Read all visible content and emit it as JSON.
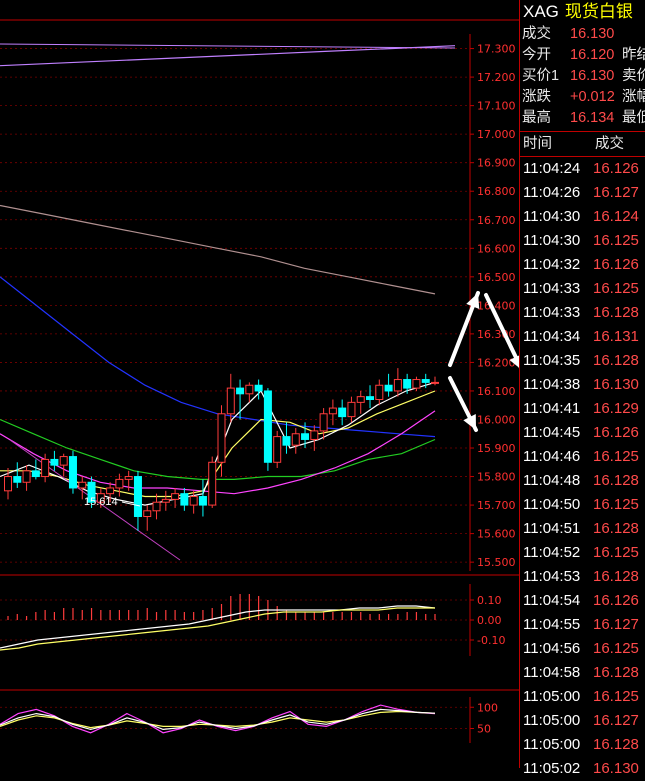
{
  "header": {
    "code": "XAG",
    "name": "现货白银"
  },
  "quote": [
    {
      "label": "成交",
      "value": "16.130",
      "extra": ""
    },
    {
      "label": "今开",
      "value": "16.120",
      "extra": "昨结"
    },
    {
      "label": "买价1",
      "value": "16.130",
      "extra": "卖价"
    },
    {
      "label": "涨跌",
      "value": "+0.012",
      "extra": "涨幅"
    },
    {
      "label": "最高",
      "value": "16.134",
      "extra": "最低"
    }
  ],
  "trades_header": {
    "time": "时间",
    "price": "成交"
  },
  "trades": [
    {
      "time": "11:04:24",
      "price": "16.126"
    },
    {
      "time": "11:04:26",
      "price": "16.127"
    },
    {
      "time": "11:04:30",
      "price": "16.124"
    },
    {
      "time": "11:04:30",
      "price": "16.125"
    },
    {
      "time": "11:04:32",
      "price": "16.126"
    },
    {
      "time": "11:04:33",
      "price": "16.125"
    },
    {
      "time": "11:04:33",
      "price": "16.128"
    },
    {
      "time": "11:04:34",
      "price": "16.131"
    },
    {
      "time": "11:04:35",
      "price": "16.128"
    },
    {
      "time": "11:04:38",
      "price": "16.130"
    },
    {
      "time": "11:04:41",
      "price": "16.129"
    },
    {
      "time": "11:04:45",
      "price": "16.126"
    },
    {
      "time": "11:04:46",
      "price": "16.125"
    },
    {
      "time": "11:04:48",
      "price": "16.128"
    },
    {
      "time": "11:04:50",
      "price": "16.125"
    },
    {
      "time": "11:04:51",
      "price": "16.128"
    },
    {
      "time": "11:04:52",
      "price": "16.125"
    },
    {
      "time": "11:04:53",
      "price": "16.128"
    },
    {
      "time": "11:04:54",
      "price": "16.126"
    },
    {
      "time": "11:04:55",
      "price": "16.127"
    },
    {
      "time": "11:04:56",
      "price": "16.125"
    },
    {
      "time": "11:04:58",
      "price": "16.128"
    },
    {
      "time": "11:05:00",
      "price": "16.125"
    },
    {
      "time": "11:05:00",
      "price": "16.127"
    },
    {
      "time": "11:05:00",
      "price": "16.128"
    },
    {
      "time": "11:05:02",
      "price": "16.130"
    }
  ],
  "chart_data": [
    {
      "type": "candlestick",
      "ylim": [
        15.49,
        17.33
      ],
      "yticks": [
        "17.300",
        "17.200",
        "17.100",
        "17.000",
        "16.900",
        "16.800",
        "16.700",
        "16.600",
        "16.500",
        "16.400",
        "16.300",
        "16.200",
        "16.100",
        "16.000",
        "15.900",
        "15.800",
        "15.700",
        "15.600",
        "15.500"
      ],
      "annotation": "15.614",
      "colors": {
        "up": "#ff3c3c",
        "down": "#00ffff",
        "axis": "#ff3030",
        "grid": "#8b0000"
      },
      "candles": [
        {
          "o": 15.75,
          "h": 15.83,
          "l": 15.72,
          "c": 15.8
        },
        {
          "o": 15.8,
          "h": 15.85,
          "l": 15.76,
          "c": 15.78
        },
        {
          "o": 15.78,
          "h": 15.84,
          "l": 15.75,
          "c": 15.82
        },
        {
          "o": 15.82,
          "h": 15.86,
          "l": 15.79,
          "c": 15.8
        },
        {
          "o": 15.8,
          "h": 15.88,
          "l": 15.78,
          "c": 15.86
        },
        {
          "o": 15.86,
          "h": 15.89,
          "l": 15.82,
          "c": 15.84
        },
        {
          "o": 15.84,
          "h": 15.88,
          "l": 15.8,
          "c": 15.87
        },
        {
          "o": 15.87,
          "h": 15.89,
          "l": 15.74,
          "c": 15.76
        },
        {
          "o": 15.76,
          "h": 15.8,
          "l": 15.72,
          "c": 15.78
        },
        {
          "o": 15.78,
          "h": 15.8,
          "l": 15.69,
          "c": 15.71
        },
        {
          "o": 15.71,
          "h": 15.76,
          "l": 15.69,
          "c": 15.74
        },
        {
          "o": 15.74,
          "h": 15.78,
          "l": 15.71,
          "c": 15.76
        },
        {
          "o": 15.76,
          "h": 15.81,
          "l": 15.73,
          "c": 15.79
        },
        {
          "o": 15.79,
          "h": 15.82,
          "l": 15.75,
          "c": 15.8
        },
        {
          "o": 15.8,
          "h": 15.82,
          "l": 15.61,
          "c": 15.66
        },
        {
          "o": 15.66,
          "h": 15.7,
          "l": 15.61,
          "c": 15.68
        },
        {
          "o": 15.68,
          "h": 15.74,
          "l": 15.65,
          "c": 15.71
        },
        {
          "o": 15.71,
          "h": 15.75,
          "l": 15.68,
          "c": 15.72
        },
        {
          "o": 15.72,
          "h": 15.76,
          "l": 15.69,
          "c": 15.74
        },
        {
          "o": 15.74,
          "h": 15.76,
          "l": 15.68,
          "c": 15.7
        },
        {
          "o": 15.7,
          "h": 15.75,
          "l": 15.67,
          "c": 15.73
        },
        {
          "o": 15.73,
          "h": 15.79,
          "l": 15.66,
          "c": 15.7
        },
        {
          "o": 15.7,
          "h": 15.87,
          "l": 15.69,
          "c": 15.85
        },
        {
          "o": 15.85,
          "h": 16.05,
          "l": 15.8,
          "c": 16.02
        },
        {
          "o": 16.02,
          "h": 16.16,
          "l": 15.99,
          "c": 16.11
        },
        {
          "o": 16.11,
          "h": 16.14,
          "l": 16.0,
          "c": 16.09
        },
        {
          "o": 16.09,
          "h": 16.13,
          "l": 16.06,
          "c": 16.12
        },
        {
          "o": 16.12,
          "h": 16.14,
          "l": 16.07,
          "c": 16.1
        },
        {
          "o": 16.1,
          "h": 16.11,
          "l": 15.82,
          "c": 15.85
        },
        {
          "o": 15.85,
          "h": 15.96,
          "l": 15.83,
          "c": 15.94
        },
        {
          "o": 15.94,
          "h": 15.99,
          "l": 15.88,
          "c": 15.91
        },
        {
          "o": 15.91,
          "h": 15.97,
          "l": 15.88,
          "c": 15.95
        },
        {
          "o": 15.95,
          "h": 15.99,
          "l": 15.9,
          "c": 15.93
        },
        {
          "o": 15.93,
          "h": 15.98,
          "l": 15.89,
          "c": 15.96
        },
        {
          "o": 15.96,
          "h": 16.04,
          "l": 15.93,
          "c": 16.02
        },
        {
          "o": 16.02,
          "h": 16.07,
          "l": 15.98,
          "c": 16.04
        },
        {
          "o": 16.04,
          "h": 16.07,
          "l": 15.98,
          "c": 16.01
        },
        {
          "o": 16.01,
          "h": 16.08,
          "l": 15.99,
          "c": 16.06
        },
        {
          "o": 16.06,
          "h": 16.1,
          "l": 16.02,
          "c": 16.08
        },
        {
          "o": 16.08,
          "h": 16.12,
          "l": 16.04,
          "c": 16.07
        },
        {
          "o": 16.07,
          "h": 16.14,
          "l": 16.05,
          "c": 16.12
        },
        {
          "o": 16.12,
          "h": 16.16,
          "l": 16.08,
          "c": 16.1
        },
        {
          "o": 16.1,
          "h": 16.18,
          "l": 16.08,
          "c": 16.14
        },
        {
          "o": 16.14,
          "h": 16.16,
          "l": 16.09,
          "c": 16.11
        },
        {
          "o": 16.11,
          "h": 16.15,
          "l": 16.1,
          "c": 16.14
        },
        {
          "o": 16.14,
          "h": 16.16,
          "l": 16.11,
          "c": 16.13
        },
        {
          "o": 16.13,
          "h": 16.15,
          "l": 16.12,
          "c": 16.13
        }
      ],
      "lines": [
        {
          "color": "#c080ff",
          "values": [
            17.24,
            17.25,
            17.26,
            17.27,
            17.28,
            17.29,
            17.3,
            17.31
          ]
        },
        {
          "color": "#b09090",
          "values": [
            16.75,
            16.72,
            16.69,
            16.66,
            16.63,
            16.6,
            16.57,
            16.53,
            16.5,
            16.47,
            16.44
          ]
        },
        {
          "color": "#2233ff",
          "values": [
            16.5,
            16.4,
            16.3,
            16.2,
            16.12,
            16.06,
            16.02,
            16.0,
            15.98,
            15.97,
            15.96,
            15.95,
            15.94
          ]
        },
        {
          "color": "#22cc22",
          "values": [
            16.0,
            15.95,
            15.9,
            15.86,
            15.82,
            15.8,
            15.79,
            15.79,
            15.8,
            15.8,
            15.82,
            15.86,
            15.88,
            15.93
          ]
        },
        {
          "color": "#ff44ff",
          "values": [
            15.95,
            15.88,
            15.82,
            15.78,
            15.76,
            15.76,
            15.75,
            15.74,
            15.76,
            15.79,
            15.83,
            15.88,
            15.95,
            16.03
          ]
        },
        {
          "color": "#ffff66",
          "values": [
            15.82,
            15.82,
            15.8,
            15.77,
            15.75,
            15.73,
            15.73,
            15.75,
            15.9,
            16.0,
            15.99,
            15.95,
            15.97,
            16.02,
            16.06,
            16.1
          ]
        },
        {
          "color": "#ffffff",
          "values": [
            15.8,
            15.84,
            15.8,
            15.75,
            15.72,
            15.7,
            15.72,
            15.74,
            16.0,
            16.1,
            15.9,
            15.93,
            15.98,
            16.05,
            16.1,
            16.13
          ]
        }
      ]
    },
    {
      "type": "bar",
      "yticks": [
        "0.10",
        "0.00",
        "-0.10"
      ],
      "ylim": [
        -0.15,
        0.15
      ],
      "values": [
        0.02,
        0.03,
        0.02,
        0.04,
        0.05,
        0.04,
        0.06,
        0.06,
        0.05,
        0.06,
        0.05,
        0.05,
        0.05,
        0.05,
        0.05,
        0.06,
        0.04,
        0.05,
        0.05,
        0.04,
        0.04,
        0.05,
        0.06,
        0.08,
        0.12,
        0.13,
        0.13,
        0.12,
        0.1,
        0.07,
        0.05,
        0.04,
        0.04,
        0.04,
        0.04,
        0.04,
        0.04,
        0.04,
        0.04,
        0.03,
        0.03,
        0.03,
        0.03,
        0.04,
        0.04,
        0.03,
        0.03
      ],
      "lines": [
        {
          "color": "#ffffff",
          "values": [
            -0.14,
            -0.12,
            -0.1,
            -0.09,
            -0.08,
            -0.07,
            -0.06,
            -0.05,
            -0.04,
            -0.03,
            -0.02,
            0.0,
            0.02,
            0.04,
            0.05,
            0.05,
            0.05,
            0.05,
            0.05,
            0.06,
            0.06,
            0.07,
            0.07,
            0.06
          ]
        },
        {
          "color": "#ffff66",
          "values": [
            -0.15,
            -0.14,
            -0.12,
            -0.11,
            -0.1,
            -0.09,
            -0.08,
            -0.07,
            -0.06,
            -0.05,
            -0.04,
            -0.03,
            -0.01,
            0.01,
            0.03,
            0.04,
            0.04,
            0.04,
            0.05,
            0.05,
            0.05,
            0.06,
            0.06,
            0.06
          ]
        }
      ]
    },
    {
      "type": "line",
      "yticks": [
        "100",
        "50"
      ],
      "ylim": [
        30,
        110
      ],
      "lines": [
        {
          "color": "#ff44ff",
          "values": [
            60,
            85,
            95,
            80,
            55,
            40,
            60,
            85,
            65,
            40,
            50,
            70,
            55,
            45,
            55,
            75,
            90,
            60,
            55,
            70,
            90,
            105,
            95,
            88,
            85
          ]
        },
        {
          "color": "#ffff66",
          "values": [
            55,
            70,
            80,
            75,
            62,
            52,
            58,
            68,
            62,
            55,
            55,
            60,
            58,
            55,
            58,
            65,
            75,
            70,
            65,
            70,
            80,
            88,
            90,
            88,
            86
          ]
        },
        {
          "color": "#ffffff",
          "values": [
            58,
            75,
            85,
            78,
            60,
            48,
            58,
            75,
            64,
            48,
            52,
            65,
            57,
            50,
            56,
            70,
            82,
            65,
            60,
            70,
            85,
            95,
            92,
            88,
            86
          ]
        }
      ]
    }
  ]
}
